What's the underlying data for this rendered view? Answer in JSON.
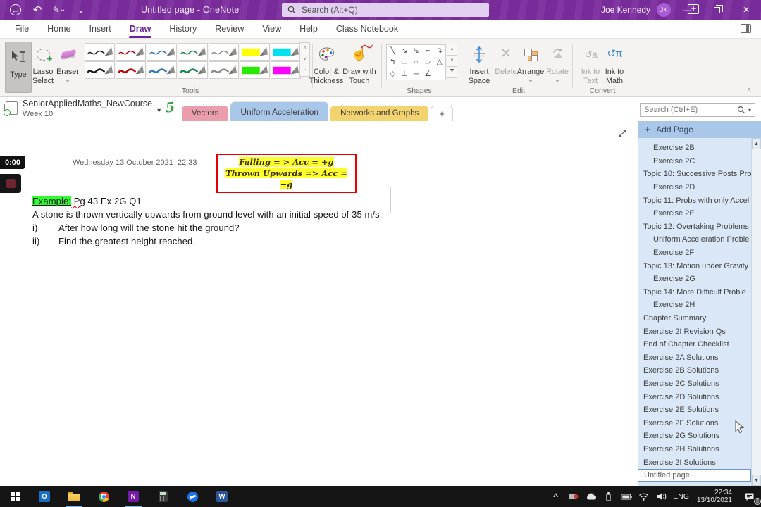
{
  "titlebar": {
    "title": "Untitled page  -  OneNote",
    "search_placeholder": "Search (Alt+Q)",
    "user_name": "Joe Kennedy",
    "user_initials": "JK"
  },
  "ribbon": {
    "tabs": [
      "File",
      "Home",
      "Insert",
      "Draw",
      "History",
      "Review",
      "View",
      "Help",
      "Class Notebook"
    ],
    "active_tab": "Draw",
    "buttons": {
      "type": "Type",
      "lasso": "Lasso Select",
      "eraser": "Eraser",
      "color_thickness": "Color & Thickness",
      "draw_touch": "Draw with Touch",
      "insert_space": "Insert Space",
      "delete": "Delete",
      "arrange": "Arrange",
      "rotate": "Rotate",
      "ink_text": "Ink to Text",
      "ink_math": "Ink to Math"
    },
    "groups": {
      "tools": "Tools",
      "shapes": "Shapes",
      "edit": "Edit",
      "convert": "Convert"
    },
    "pen_gallery": [
      {
        "kind": "pen",
        "color": "#1a1a1a",
        "w": 1.6
      },
      {
        "kind": "pen",
        "color": "#c00000",
        "w": 1.6
      },
      {
        "kind": "pen",
        "color": "#2e75b6",
        "w": 1.6
      },
      {
        "kind": "pen",
        "color": "#0e8a44",
        "w": 1.6
      },
      {
        "kind": "pen",
        "color": "#8c8c8c",
        "w": 1.6
      },
      {
        "kind": "hl",
        "color": "#ffff00"
      },
      {
        "kind": "hl",
        "color": "#00e0f0"
      },
      {
        "kind": "pen",
        "color": "#1a1a1a",
        "w": 2.6
      },
      {
        "kind": "pen",
        "color": "#c00000",
        "w": 2.6
      },
      {
        "kind": "pen",
        "color": "#2e75b6",
        "w": 2.6
      },
      {
        "kind": "pen",
        "color": "#0e8a44",
        "w": 2.6
      },
      {
        "kind": "pen",
        "color": "#8c8c8c",
        "w": 2.6
      },
      {
        "kind": "hl",
        "color": "#2be800"
      },
      {
        "kind": "hl",
        "color": "#ff00ff"
      }
    ],
    "shape_glyphs": [
      {
        "name": "line",
        "glyph": "╲"
      },
      {
        "name": "arrow",
        "glyph": "↘"
      },
      {
        "name": "double-arrow",
        "glyph": "⇘"
      },
      {
        "name": "elbow-connector",
        "glyph": "⌐"
      },
      {
        "name": "elbow-arrow",
        "glyph": "↴"
      },
      {
        "name": "elbow-arrow-up",
        "glyph": "↰"
      },
      {
        "name": "rectangle",
        "glyph": "▭"
      },
      {
        "name": "ellipse",
        "glyph": "○"
      },
      {
        "name": "parallelogram",
        "glyph": "▱"
      },
      {
        "name": "triangle",
        "glyph": "△"
      },
      {
        "name": "diamond",
        "glyph": "◇"
      },
      {
        "name": "axes",
        "glyph": "⊥"
      },
      {
        "name": "cross-axes",
        "glyph": "┼"
      },
      {
        "name": "slope-graph",
        "glyph": "∠"
      },
      {
        "name": "blank",
        "glyph": ""
      }
    ]
  },
  "notebook": {
    "name": "SeniorAppliedMaths_NewCourse",
    "week": "Week 10"
  },
  "sections": [
    {
      "label": "Vectors",
      "color": "#ea9daa",
      "active": false
    },
    {
      "label": "Uniform Acceleration",
      "color": "#a9c7e8",
      "active": true
    },
    {
      "label": "Networks and Graphs",
      "color": "#f2d36e",
      "active": false
    },
    {
      "label": "+",
      "color": "#ffffff",
      "active": false
    }
  ],
  "page_search_placeholder": "Search (Ctrl+E)",
  "canvas": {
    "timer": "0:00",
    "date": "Wednesday 13 October 2021",
    "time": "22:33",
    "note_line1": "Falling = > Acc =  +g",
    "note_line2": "Thrown Upwards => Acc =  −g",
    "example_label": "Example:",
    "example_pg": " Pg",
    "example_ref": " 43 Ex 2G Q1",
    "body_line": "A stone is thrown vertically upwards from ground level with an initial speed of 35 m/s.",
    "item1_num": "i)",
    "item1_text": "After how long will the stone hit the ground?",
    "item2_num": "ii)",
    "item2_text": "Find the greatest height reached."
  },
  "sidebar": {
    "add_page": "Add Page",
    "pages": [
      {
        "label": "Exercise 2B",
        "indent": true
      },
      {
        "label": "Exercise 2C",
        "indent": true
      },
      {
        "label": "Topic 10: Successive Posts Pro",
        "indent": false
      },
      {
        "label": "Exercise 2D",
        "indent": true
      },
      {
        "label": "Topic 11: Probs with only Accel",
        "indent": false
      },
      {
        "label": "Exercise 2E",
        "indent": true
      },
      {
        "label": "Topic 12: Overtaking Problems",
        "indent": false
      },
      {
        "label": "Uniform Acceleration Proble",
        "indent": true
      },
      {
        "label": "Exercise 2F",
        "indent": true
      },
      {
        "label": "Topic 13: Motion under Gravity",
        "indent": false
      },
      {
        "label": "Exercise 2G",
        "indent": true
      },
      {
        "label": "Topic 14: More Difficult Proble",
        "indent": false
      },
      {
        "label": "Exercise 2H",
        "indent": true
      },
      {
        "label": "Chapter Summary",
        "indent": false
      },
      {
        "label": "Exercise 2I Revision Qs",
        "indent": false
      },
      {
        "label": "End of Chapter Checklist",
        "indent": false
      },
      {
        "label": "Exercise 2A Solutions",
        "indent": false
      },
      {
        "label": "Exercise 2B Solutions",
        "indent": false
      },
      {
        "label": "Exercise 2C Solutions",
        "indent": false
      },
      {
        "label": "Exercise 2D Solutions",
        "indent": false
      },
      {
        "label": "Exercise 2E Solutions",
        "indent": false
      },
      {
        "label": "Exercise 2F Solutions",
        "indent": false
      },
      {
        "label": "Exercise 2G Solutions",
        "indent": false
      },
      {
        "label": "Exercise 2H Solutions",
        "indent": false
      },
      {
        "label": "Exercise 2I Solutions",
        "indent": false
      },
      {
        "label": "Untitled page",
        "indent": false,
        "selected": true
      }
    ]
  },
  "taskbar": {
    "lang": "ENG",
    "time": "22:34",
    "date": "13/10/2021",
    "badge": "3"
  }
}
